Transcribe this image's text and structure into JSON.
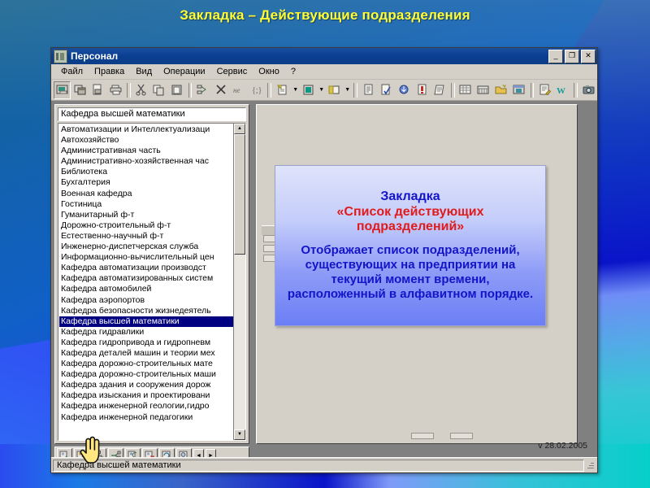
{
  "slide": {
    "title": "Закладка – Действующие подразделения",
    "title_color": "#ffff33"
  },
  "window": {
    "title": "Персонал",
    "icon": "app-icon",
    "buttons": {
      "minimize": "_",
      "maximize": "❐",
      "close": "✕"
    }
  },
  "menu": {
    "items": [
      {
        "label": "Файл"
      },
      {
        "label": "Правка"
      },
      {
        "label": "Вид"
      },
      {
        "label": "Операции"
      },
      {
        "label": "Сервис"
      },
      {
        "label": "Окно"
      },
      {
        "label": "?"
      }
    ]
  },
  "toolbar": {
    "buttons": [
      {
        "name": "open-card-icon"
      },
      {
        "name": "new-window-icon"
      },
      {
        "name": "copy-doc-icon"
      },
      {
        "name": "print-icon"
      },
      {
        "name": "cut-icon"
      },
      {
        "name": "copy-icon"
      },
      {
        "name": "paste-icon"
      },
      {
        "name": "structure-icon"
      },
      {
        "name": "delete-x-icon"
      },
      {
        "name": "no-filter-icon"
      },
      {
        "name": "braces-icon"
      },
      {
        "name": "new-doc-icon"
      },
      {
        "name": "green-card-icon"
      },
      {
        "name": "yellow-card-icon"
      },
      {
        "name": "report-icon"
      },
      {
        "name": "check-doc-icon"
      },
      {
        "name": "import-icon"
      },
      {
        "name": "warning-doc-icon"
      },
      {
        "name": "note-icon"
      },
      {
        "name": "table-icon"
      },
      {
        "name": "grid-icon"
      },
      {
        "name": "open-folder-icon"
      },
      {
        "name": "window-props-icon"
      },
      {
        "name": "edit-list-icon"
      },
      {
        "name": "word-icon"
      },
      {
        "name": "camera-icon"
      }
    ]
  },
  "dept_panel": {
    "search_value": "Кафедра высшей математики",
    "selected_index": 18,
    "items": [
      "Автоматизации и Интеллектуализаци",
      "Автохозяйство",
      "Административная часть",
      "Административно-хозяйственная час",
      "Библиотека",
      "Бухгалтерия",
      "Военная кафедра",
      "Гостиница",
      "Гуманитарный ф-т",
      "Дорожно-строительный ф-т",
      "Естественно-научный ф-т",
      "Инженерно-диспетчерская служба",
      "Информационно-вычислительный цен",
      "Кафедра автоматизации производст",
      "Кафедра автоматизированных систем",
      "Кафедра автомобилей",
      "Кафедра аэропортов",
      "Кафедра безопасности жизнедеятель",
      "Кафедра высшей математики",
      "Кафедра гидравлики",
      "Кафедра гидропривода и гидропневм",
      "Кафедра деталей машин и теории мех",
      "Кафедра дорожно-строительных мате",
      "Кафедра дорожно-строительных маши",
      "Кафедра здания и сооружения дорож",
      "Кафедра изыскания и проектировани",
      "Кафедра инженерной геологии,гидро",
      "Кафедра инженерной педагогики"
    ],
    "scroll_up": "▲",
    "scroll_down": "▼",
    "bottom_buttons": [
      {
        "name": "add-record-icon"
      },
      {
        "name": "edit-record-icon"
      },
      {
        "name": "tree-icon"
      },
      {
        "name": "link-icon"
      },
      {
        "name": "refresh-icon"
      },
      {
        "name": "delete-record-icon"
      },
      {
        "name": "reload-icon"
      },
      {
        "name": "info-icon"
      }
    ],
    "nav_prev": "◄",
    "nav_next": "►"
  },
  "child_window": {
    "date_label": "v 28.02.2005"
  },
  "statusbar": {
    "text": "Кафедра высшей математики"
  },
  "callout": {
    "line1": "Закладка",
    "line2": "«Список действующих подразделений»",
    "body": "Отображает список подразделений, существующих на предприятии на текущий момент времени, расположенный в алфавитном порядке.",
    "color_primary": "#1414c8",
    "color_accent": "#e01b1b"
  },
  "cursor": {
    "name": "hand-cursor"
  }
}
